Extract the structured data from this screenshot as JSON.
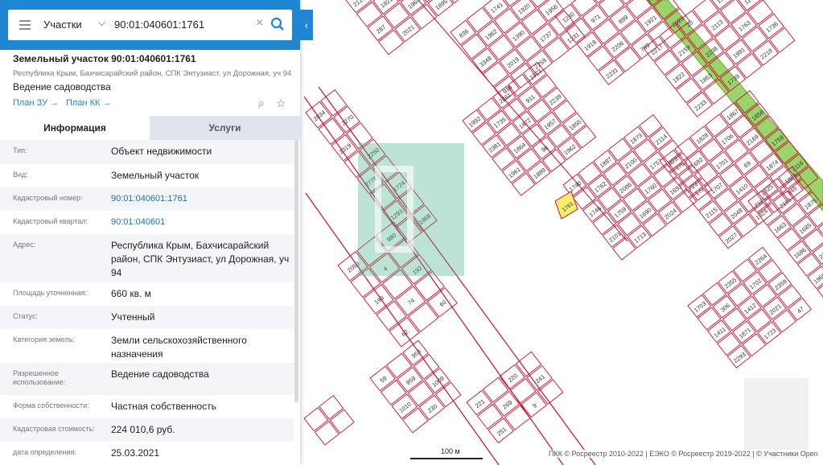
{
  "search": {
    "type_label": "Участки",
    "query": "90:01:040601:1761"
  },
  "parcel": {
    "title": "Земельный участок 90:01:040601:1761",
    "address_short": "Республика Крым, Бахчисарайский район, СПК Энтузиаст, ул Дорожная, уч 94",
    "usage": "Ведение садоводства",
    "plan_zu": "План ЗУ →",
    "plan_kk": "План КК →"
  },
  "tabs": {
    "info": "Информация",
    "services": "Услуги"
  },
  "info_rows": [
    {
      "k": "Тип:",
      "v": "Объект недвижимости"
    },
    {
      "k": "Вид:",
      "v": "Земельный участок"
    },
    {
      "k": "Кадастровый номер:",
      "v": "90:01:040601:1761"
    },
    {
      "k": "Кадастровый квартал:",
      "v": "90:01:040601"
    },
    {
      "k": "Адрес:",
      "v": "Республика Крым, Бахчисарайский район, СПК Энтузиаст, ул Дорожная, уч 94"
    },
    {
      "k": "Площадь уточненная:",
      "v": "660 кв. м"
    },
    {
      "k": "Статус:",
      "v": "Учтенный"
    },
    {
      "k": "Категория земель:",
      "v": "Земли сельскохозяйственного назначения"
    },
    {
      "k": "Разрешенное использование:",
      "v": "Ведение садоводства"
    },
    {
      "k": "Форма собственности:",
      "v": "Частная собственность"
    },
    {
      "k": "Кадастровая стоимость:",
      "v": "224 010,6 руб."
    },
    {
      "k": "дата определения:",
      "v": "25.03.2021"
    }
  ],
  "map": {
    "scale_label": "100 м",
    "credit": "ПКК © Росреестр 2010-2022 | ЕЭКО © Росреестр 2019-2022 | © Участники Open",
    "highlight_label": "1761",
    "colors": {
      "parcel_stroke": "#c8102e",
      "highlight_fill": "#f7ee6e",
      "road": "#9bd46b",
      "watermark": "#43b08a",
      "panel_header": "#1f86d3"
    },
    "labels": [
      "2125",
      "1979",
      "2211",
      "1821",
      "2237",
      "287",
      "1964",
      "2083",
      "2021",
      "1895",
      "836",
      "1741",
      "1913",
      "1962",
      "1920",
      "3348",
      "1390",
      "1956",
      "2019",
      "1737",
      "916",
      "2259",
      "1231",
      "1230",
      "1850",
      "2118",
      "971",
      "1744",
      "1918",
      "899",
      "2114",
      "2206",
      "1921",
      "2231",
      "799",
      "2023",
      "2217",
      "20",
      "1922",
      "2159",
      "2113",
      "1170",
      "1822",
      "2238",
      "1763",
      "1863",
      "1991",
      "1736",
      "2233",
      "1739",
      "2218",
      "1992",
      "2261",
      "1923",
      "1735",
      "911",
      "2381",
      "1872",
      "2239",
      "1864",
      "1957",
      "1961",
      "96",
      "1855",
      "1889",
      "1962",
      "1740",
      "1887",
      "1873",
      "1762",
      "2100",
      "2114",
      "1746",
      "2086",
      "1757",
      "1759",
      "1760",
      "1761",
      "2101",
      "1690",
      "1691",
      "1713",
      "2024",
      "1727",
      "1823",
      "1828",
      "1867",
      "1692",
      "1706",
      "1856",
      "1723",
      "1701",
      "2169",
      "1707",
      "69",
      "1758",
      "2115",
      "1410",
      "1874",
      "2048",
      "2025",
      "2116",
      "2027",
      "1924",
      "145",
      "2185",
      "1868",
      "2186",
      "1663",
      "1875",
      "1685",
      "1686",
      "2208",
      "2200",
      "1965",
      "2262",
      "2028",
      "1870",
      "1729",
      "1703",
      "2355",
      "2264",
      "306",
      "1702",
      "1411",
      "1412",
      "2359",
      "1871",
      "2021",
      "2293",
      "1723",
      "47",
      "2034",
      "2270",
      "2319",
      "2250",
      "2778",
      "1724",
      "1293",
      "1968",
      "2050",
      "980",
      "4",
      "193",
      "192",
      "74",
      "62",
      "60",
      "59",
      "958",
      "959",
      "1010",
      "1009",
      "230",
      "221",
      "220",
      "269",
      "241",
      "251",
      "9"
    ]
  }
}
